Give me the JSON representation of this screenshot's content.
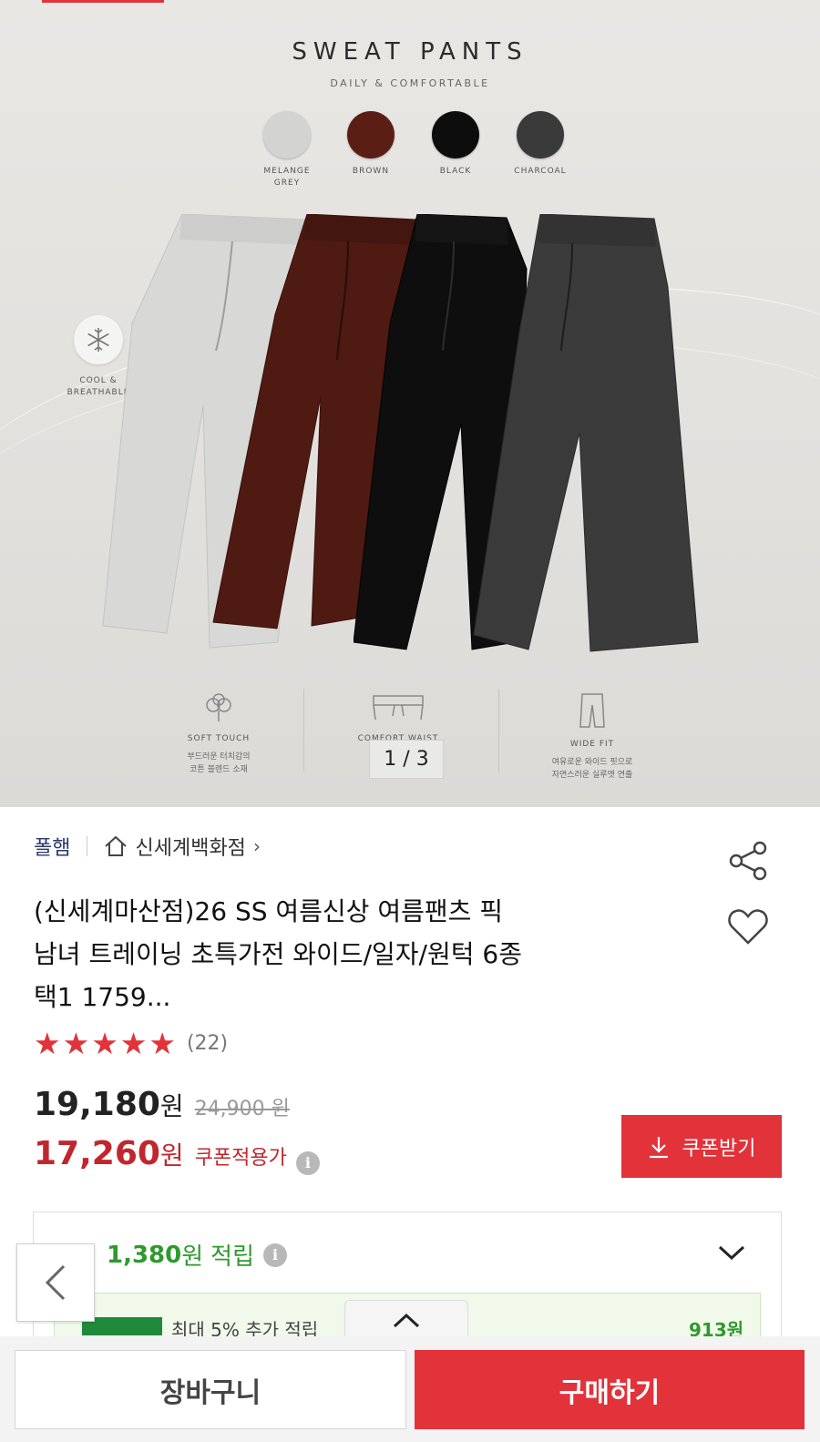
{
  "hero": {
    "title": "SWEAT PANTS",
    "subtitle": "DAILY & COMFORTABLE",
    "swatches": [
      {
        "label": "MELANGE\nGREY",
        "color": "#d3d3d2"
      },
      {
        "label": "BROWN",
        "color": "#5b1e14"
      },
      {
        "label": "BLACK",
        "color": "#0d0d0d"
      },
      {
        "label": "CHARCOAL",
        "color": "#3a3a3b"
      }
    ],
    "cool_label": "COOL &\nBREATHABLE",
    "features": [
      {
        "name": "SOFT TOUCH",
        "desc": "부드러운 터치감의\n코튼 블렌드 소재"
      },
      {
        "name": "COMFORT WAIST",
        "desc": ""
      },
      {
        "name": "WIDE FIT",
        "desc": "여유로운 와이드 핏으로\n자연스러운 실루엣 연출"
      }
    ],
    "pager": "1 / 3",
    "current_image": 1,
    "total_images": 3
  },
  "product": {
    "brand": "폴햄",
    "store": "신세계백화점",
    "title_lines": [
      "(신세계마산점)26 SS 여름신상 여름팬츠 픽",
      "남녀 트레이닝 초특가전 와이드/일자/원턱 6종",
      "택1 1759..."
    ],
    "rating_stars": 5,
    "review_count": "(22)",
    "price": "19,180",
    "price_unit": "원",
    "original_price": "24,900 원",
    "coupon_price": "17,260",
    "coupon_note": "쿠폰적용가",
    "coupon_button": "쿠폰받기"
  },
  "points": {
    "prefix": "1",
    "amount": "1,380",
    "unit": "원",
    "label": "적립",
    "strip_text": "최대 5% 추가 적립",
    "strip_amount": "913원"
  },
  "bottom": {
    "cart": "장바구니",
    "buy": "구매하기"
  },
  "colors": {
    "accent": "#e2323a",
    "brand": "#2a3a6b",
    "points_green": "#2e9a2e"
  }
}
